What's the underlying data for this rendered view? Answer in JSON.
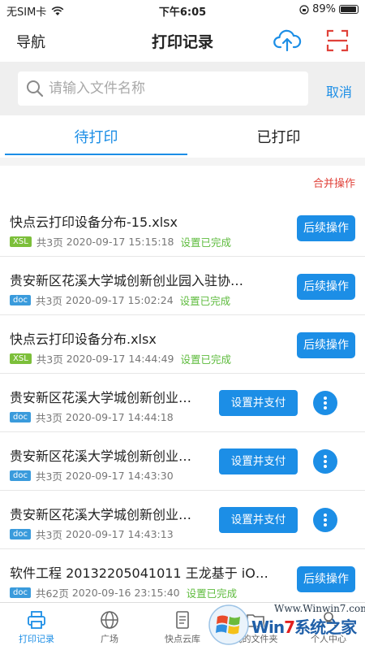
{
  "status_bar": {
    "carrier": "无SIM卡",
    "time": "下午6:05",
    "battery": "89%"
  },
  "nav": {
    "left_label": "导航",
    "title": "打印记录"
  },
  "search": {
    "placeholder": "请输入文件名称",
    "value": "",
    "cancel_label": "取消"
  },
  "tabs": [
    {
      "label": "待打印",
      "active": true
    },
    {
      "label": "已打印",
      "active": false
    }
  ],
  "merge_label": "合并操作",
  "files": [
    {
      "name": "快点云打印设备分布-15.xlsx",
      "type": "XSL",
      "pages": "共3页",
      "date": "2020-09-17 15:15:18",
      "status": "设置已完成",
      "action": "后续操作"
    },
    {
      "name": "贵安新区花溪大学城创新创业园入驻协…",
      "type": "doc",
      "pages": "共3页",
      "date": "2020-09-17 15:02:24",
      "status": "设置已完成",
      "action": "后续操作"
    },
    {
      "name": "快点云打印设备分布.xlsx",
      "type": "XSL",
      "pages": "共3页",
      "date": "2020-09-17 14:44:49",
      "status": "设置已完成",
      "action": "后续操作"
    },
    {
      "name": "贵安新区花溪大学城创新创业…",
      "type": "doc",
      "pages": "共3页",
      "date": "2020-09-17 14:44:18",
      "status": "",
      "action": "设置并支付"
    },
    {
      "name": "贵安新区花溪大学城创新创业…",
      "type": "doc",
      "pages": "共3页",
      "date": "2020-09-17 14:43:30",
      "status": "",
      "action": "设置并支付"
    },
    {
      "name": "贵安新区花溪大学城创新创业…",
      "type": "doc",
      "pages": "共3页",
      "date": "2020-09-17 14:43:13",
      "status": "",
      "action": "设置并支付"
    },
    {
      "name": "软件工程 20132205041011 王龙基于 iO…",
      "type": "doc",
      "pages": "共62页",
      "date": "2020-09-16 23:15:40",
      "status": "设置已完成",
      "action": "后续操作"
    }
  ],
  "bottom_tabs": [
    {
      "label": "打印记录",
      "icon": "printer-icon",
      "active": true
    },
    {
      "label": "广场",
      "icon": "globe-icon",
      "active": false
    },
    {
      "label": "快点云库",
      "icon": "document-icon",
      "active": false
    },
    {
      "label": "我的文件夹",
      "icon": "folder-icon",
      "active": false
    },
    {
      "label": "个人中心",
      "icon": "person-icon",
      "active": false
    }
  ],
  "watermark": {
    "url": "Www.Winwin7.com",
    "brand_pre": "Win",
    "brand_seven": "7",
    "brand_post": "系统之家"
  },
  "colors": {
    "accent": "#1c8ee6",
    "danger": "#e0423a",
    "success": "#5dbb3c",
    "xsl_tag": "#7cbf3a",
    "doc_tag": "#3a9bdc"
  }
}
